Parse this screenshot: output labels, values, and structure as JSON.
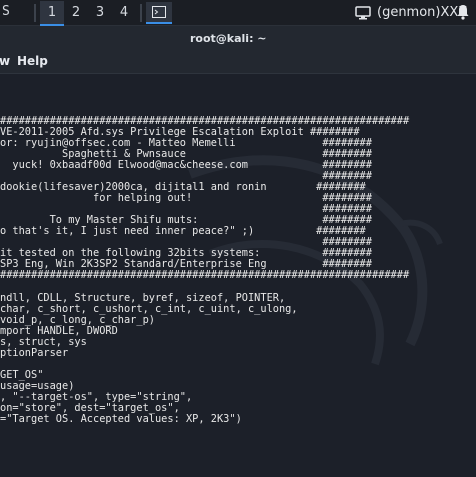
{
  "panel": {
    "cut_label": "S",
    "workspaces": [
      "1",
      "2",
      "3",
      "4"
    ],
    "active_workspace": "1",
    "genmon_text": "(genmon)XXX",
    "accent": "#3a8ee6"
  },
  "window": {
    "title": "root@kali: ~"
  },
  "menubar": {
    "items": [
      "w",
      "Help"
    ]
  },
  "terminal": {
    "lines": [
      "##################################################################",
      "VE-2011-2005 Afd.sys Privilege Escalation Exploit ########",
      "or: ryujin@offsec.com - Matteo Memelli              ########",
      "          Spaghetti & Pwnsauce                      ########",
      "  yuck! 0xbaadf00d Elwood@mac&cheese.com            ########",
      "                                                    ########",
      "dookie(lifesaver)2000ca, dijital1 and ronin        ########",
      "               for helping out!                     ########",
      "                                                    ########",
      "        To my Master Shifu muts:                    ########",
      "o that's it, I just need inner peace?\" ;)          ########",
      "                                                    ########",
      "it tested on the following 32bits systems:          ########",
      "SP3 Eng, Win 2K3SP2 Standard/Enterprise Eng         ########",
      "##################################################################",
      "",
      "ndll, CDLL, Structure, byref, sizeof, POINTER,",
      "char, c_short, c_ushort, c_int, c_uint, c_ulong,",
      "void_p, c_long, c_char_p)",
      "mport HANDLE, DWORD",
      "s, struct, sys",
      "ptionParser",
      "",
      "GET_OS\"",
      "usage=usage)",
      ", \"--target-os\", type=\"string\",",
      "on=\"store\", dest=\"target_os\",",
      "=\"Target OS. Accepted values: XP, 2K3\")"
    ]
  }
}
